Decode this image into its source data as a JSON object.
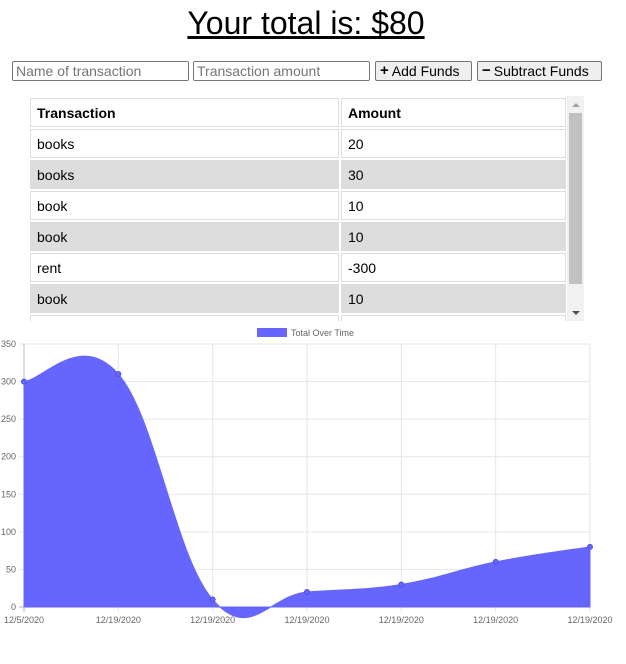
{
  "header": {
    "total_text": "Your total is: $80"
  },
  "form": {
    "name_placeholder": "Name of transaction",
    "amount_placeholder": "Transaction amount",
    "add_label": "Add Funds",
    "subtract_label": "Subtract Funds",
    "add_icon": "plus-icon",
    "subtract_icon": "minus-icon"
  },
  "table": {
    "headers": [
      "Transaction",
      "Amount"
    ],
    "rows": [
      [
        "books",
        "20"
      ],
      [
        "books",
        "30"
      ],
      [
        "book",
        "10"
      ],
      [
        "book",
        "10"
      ],
      [
        "rent",
        "-300"
      ],
      [
        "book",
        "10"
      ]
    ]
  },
  "colors": {
    "series_fill": "#6666ff",
    "row_alt": "#dddddd",
    "grid": "#e6e6e6",
    "tick_text": "#666666"
  },
  "chart_data": {
    "type": "area",
    "legend": {
      "label": "Total Over Time",
      "position": "top"
    },
    "x": [
      "12/5/2020",
      "12/19/2020",
      "12/19/2020",
      "12/19/2020",
      "12/19/2020",
      "12/19/2020",
      "12/19/2020"
    ],
    "series": [
      {
        "name": "Total Over Time",
        "values": [
          300,
          310,
          10,
          20,
          30,
          60,
          80
        ]
      }
    ],
    "ylim": [
      0,
      350
    ],
    "yticks": [
      0,
      50,
      100,
      150,
      200,
      250,
      300,
      350
    ],
    "grid": true
  }
}
